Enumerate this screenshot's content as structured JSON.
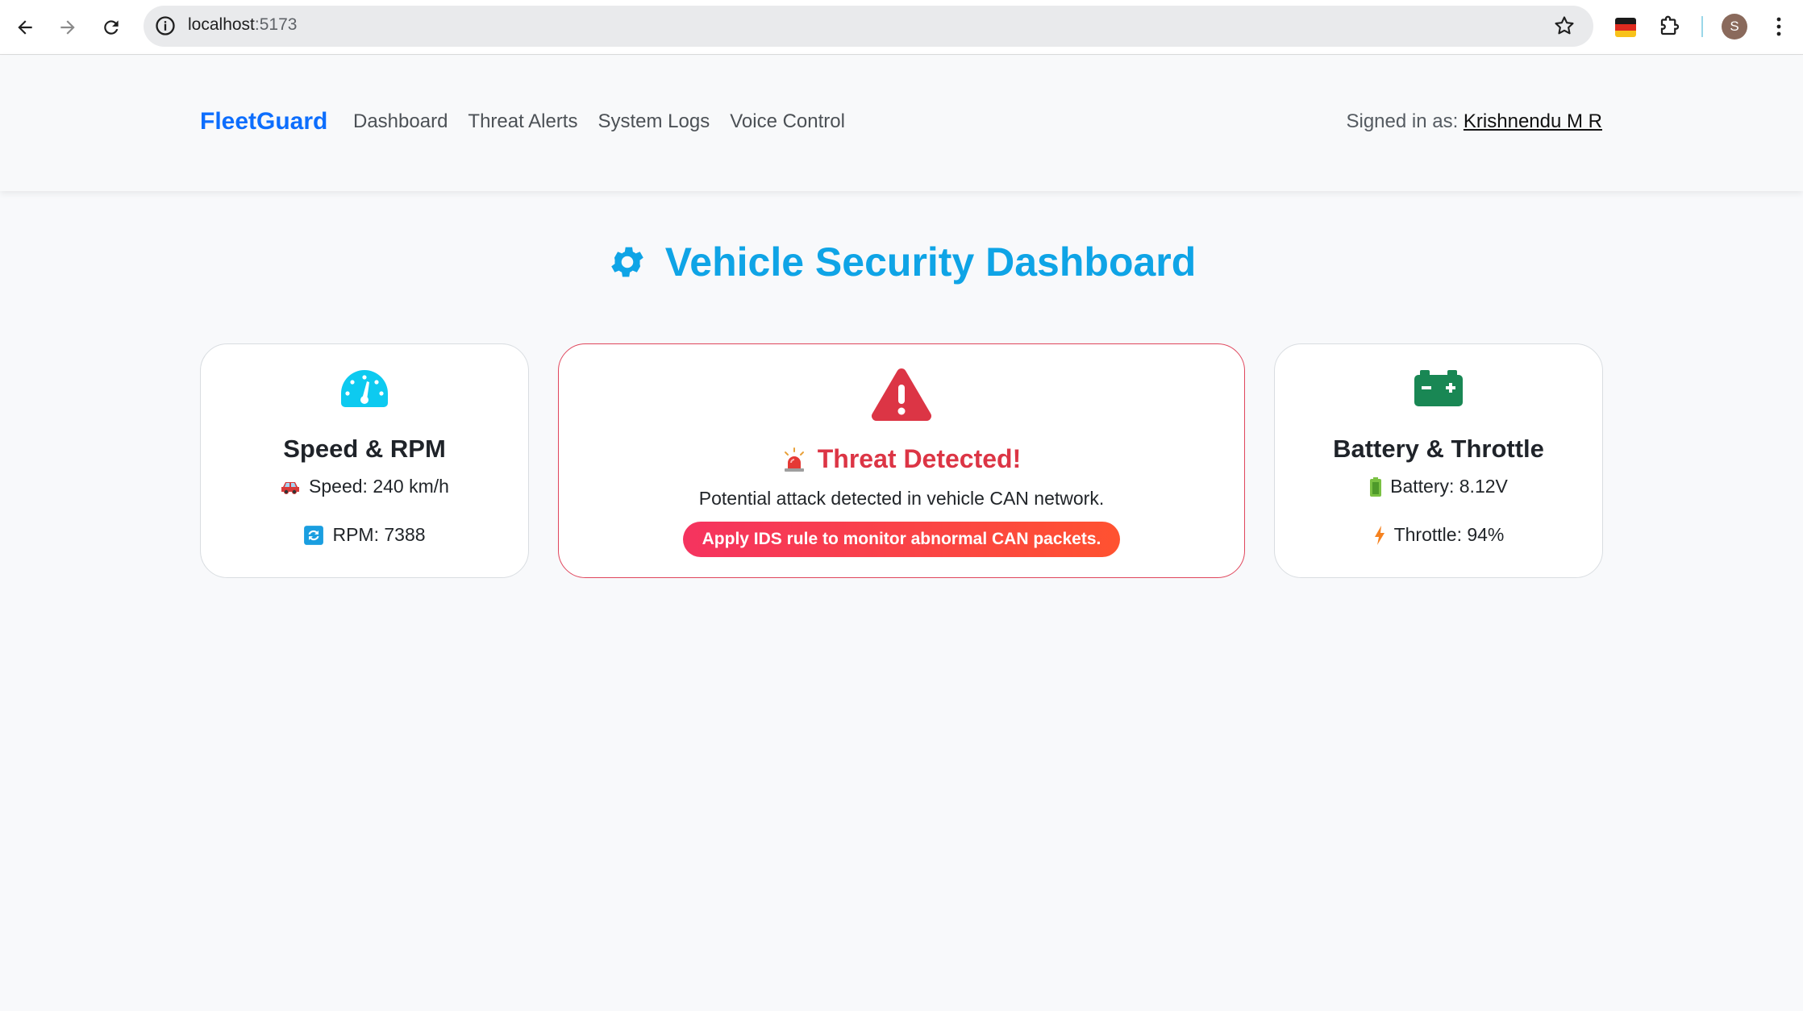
{
  "browser": {
    "url_host": "localhost",
    "url_port": ":5173",
    "profile_initial": "S"
  },
  "navbar": {
    "brand": "FleetGuard",
    "links": [
      "Dashboard",
      "Threat Alerts",
      "System Logs",
      "Voice Control"
    ],
    "signed_prefix": "Signed in as: ",
    "signed_user": "Krishnendu M R"
  },
  "page": {
    "title": "Vehicle Security Dashboard"
  },
  "cards": {
    "speed": {
      "title": "Speed & RPM",
      "speed": "Speed: 240 km/h",
      "rpm": "RPM: 7388"
    },
    "threat": {
      "title": "Threat Detected!",
      "message": "Potential attack detected in vehicle CAN network.",
      "action": "Apply IDS rule to monitor abnormal CAN packets."
    },
    "battery": {
      "title": "Battery & Throttle",
      "battery": "Battery: 8.12V",
      "throttle": "Throttle: 94%"
    }
  },
  "colors": {
    "brand": "#0d6efd",
    "title": "#0fa4e6",
    "danger": "#dc3545",
    "battery_green": "#198754",
    "speed_cyan": "#0dcaf0"
  },
  "icons": {
    "speed_card": "speedometer-icon",
    "threat_card": "warning-triangle-icon",
    "battery_card": "battery-icon",
    "heading": "gear-icon",
    "speed_row": "car-icon",
    "rpm_row": "refresh-icon",
    "threat_title": "siren-icon",
    "battery_row": "battery-small-icon",
    "throttle_row": "lightning-icon"
  }
}
